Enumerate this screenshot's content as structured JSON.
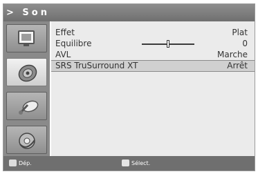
{
  "title": "> Son",
  "sidebar": {
    "items": [
      {
        "icon": "tv-screen-icon",
        "active": false
      },
      {
        "icon": "speaker-icon",
        "active": true
      },
      {
        "icon": "satellite-icon",
        "active": false
      },
      {
        "icon": "disc-icon",
        "active": false
      }
    ]
  },
  "menu": {
    "rows": [
      {
        "label": "Effet",
        "value": "Plat"
      },
      {
        "label": "Equilibre",
        "value": "0",
        "slider_position": 0.5
      },
      {
        "label": "AVL",
        "value": "Marche"
      },
      {
        "label": "SRS TruSurround XT",
        "value": "Arrêt",
        "selected": true
      }
    ]
  },
  "footer": {
    "move_label": "Dép.",
    "select_label": "Sélect."
  },
  "colors": {
    "title_bg": "#7a7a7a",
    "sidebar_bg": "#8a8a8a",
    "content_bg": "#ebebeb",
    "selected_row": "#d0d0d0",
    "footer_bg": "#6f6f6f"
  }
}
